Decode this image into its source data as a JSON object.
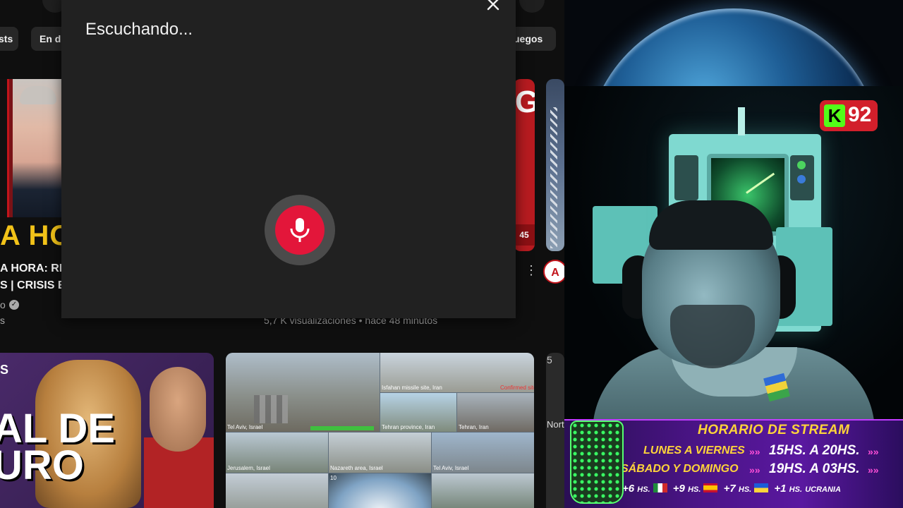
{
  "youtube": {
    "chips": [
      "sts",
      "En d",
      "uegos"
    ],
    "thumb1": {
      "headline": "A HOR"
    },
    "video1": {
      "title_line1": "A HORA: RE",
      "title_line2": "S | CRISIS EN",
      "channel": "o",
      "meta": "s"
    },
    "thumb2": {
      "letter": "G",
      "badge": "45"
    },
    "channel_avatar_text": "A",
    "video2": {
      "meta": "5,7 K visualizaciones • hace 48 minutos"
    },
    "thumb4": {
      "corner": "S",
      "text_line1": "AL DE",
      "text_line2": "URO"
    },
    "thumb5": {
      "labels": [
        "Isfahan missile site, Iran",
        "Tehran province, Iran",
        "Tehran, Iran",
        "Tel Aviv, Israel",
        "Jerusalem, Israel",
        "Nazareth area, Israel",
        "Tel Aviv, Israel",
        "10"
      ],
      "tag": "Confirmed site"
    },
    "right_edge": {
      "num": "5",
      "text": "Nort"
    }
  },
  "voice_dialog": {
    "title": "Escuchando...",
    "close_icon": "close-icon",
    "mic_icon": "microphone-icon",
    "mic_color": "#e3163a"
  },
  "stream": {
    "kick_logo": "K",
    "viewer_count": "92",
    "schedule": {
      "title": "HORARIO DE STREAM",
      "weekday_label": "LUNES A VIERNES",
      "weekday_time": "15HS. A 20HS.",
      "weekend_label": "SÁBADO Y DOMINGO",
      "weekend_time": "19HS. A 03HS.",
      "tz1": "+6",
      "tz2": "+9",
      "tz3": "+7",
      "tz4": "+1",
      "hs": "HS.",
      "ucrania": "UCRANIA"
    }
  }
}
